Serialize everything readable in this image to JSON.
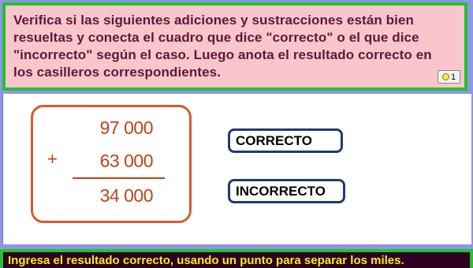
{
  "instruction": {
    "text": "Verifica si las siguientes adiciones y sustracciones están bien resueltas y conecta el cuadro que dice \"correcto\" o el que dice \"incorrecto\" según el caso. Luego anota el resultado correcto en los casilleros correspondientes.",
    "counter": "1"
  },
  "operation": {
    "first": "97 000",
    "operator": "+",
    "second": "63 000",
    "result": "34 000"
  },
  "choices": {
    "correct": "CORRECTO",
    "incorrect": "INCORRECTO"
  },
  "footer": {
    "prompt": "Ingresa el resultado correcto, usando un punto para separar los miles."
  },
  "colors": {
    "background": "#8f96e3",
    "instruction_bg": "#f9c6cc",
    "frame_green": "#22c32d",
    "operation_orange": "#c04316",
    "choice_border": "#1f3a75",
    "footer_text": "#f3ee1b"
  }
}
